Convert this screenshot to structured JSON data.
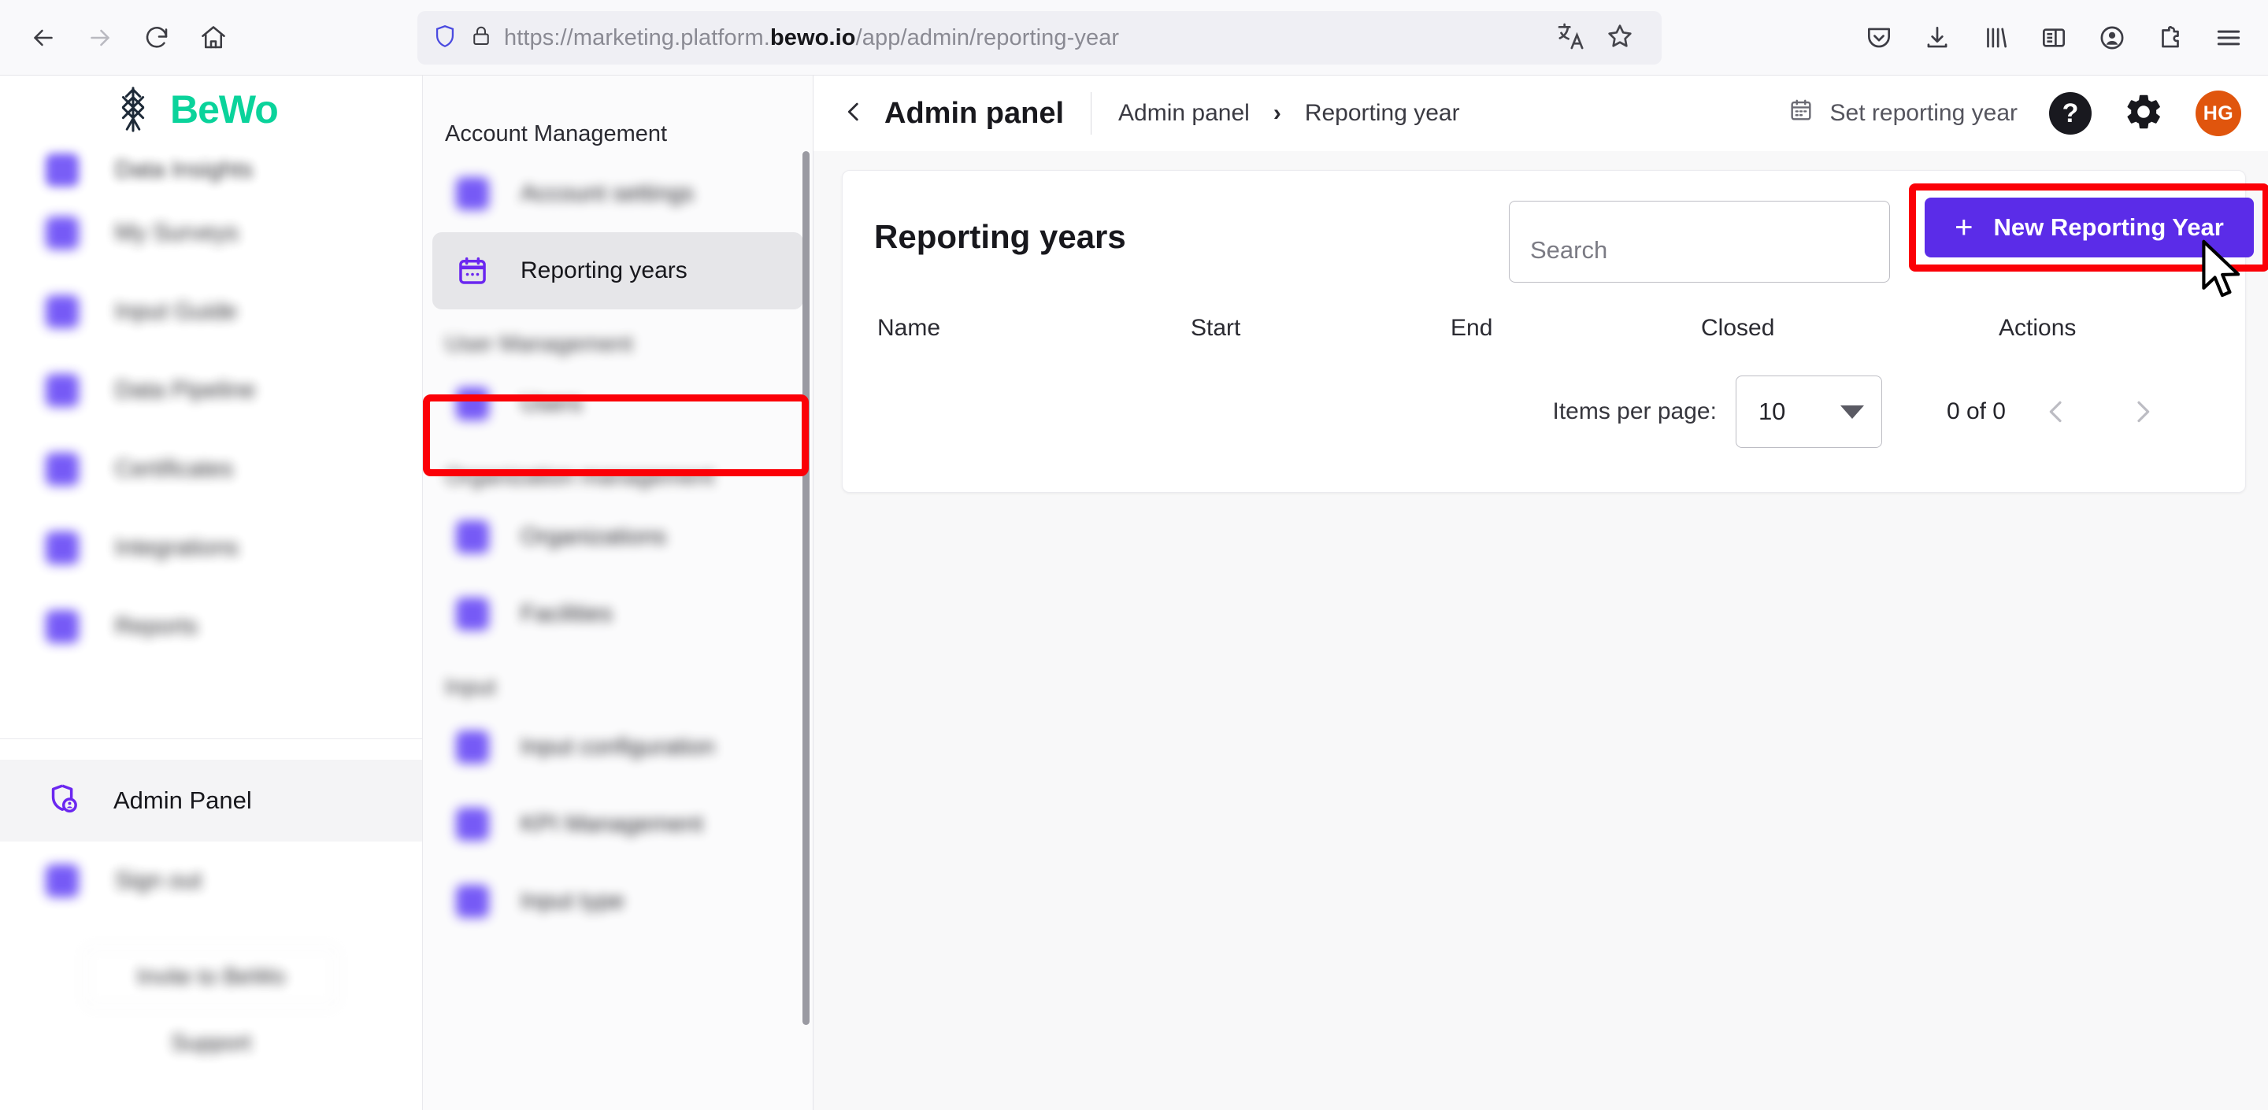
{
  "browser": {
    "url_prefix": "https://marketing.platform.",
    "url_domain": "bewo.io",
    "url_suffix": "/app/admin/reporting-year",
    "back_icon": "back-arrow-icon",
    "forward_icon": "forward-arrow-icon",
    "reload_icon": "reload-icon",
    "home_icon": "home-icon",
    "shield_icon": "shield-icon",
    "lock_icon": "lock-icon",
    "translate_icon": "translate-icon",
    "bookmark_icon": "star-icon",
    "toolbar_icons": [
      "pocket-icon",
      "download-icon",
      "library-icon",
      "sidebar-icon",
      "account-icon",
      "extensions-icon",
      "menu-icon"
    ]
  },
  "sidebar": {
    "logo_word": "BeWo",
    "items": [
      {
        "label": "Data Insights"
      },
      {
        "label": "My Surveys"
      },
      {
        "label": "Input Guide"
      },
      {
        "label": "Data Pipeline"
      },
      {
        "label": "Certificates"
      },
      {
        "label": "Integrations"
      },
      {
        "label": "Reports"
      }
    ],
    "admin_panel": "Admin Panel",
    "sign_out": "Sign out",
    "invite": "Invite to BeWo",
    "support": "Support"
  },
  "subnav": {
    "groups": [
      {
        "title": "Account Management",
        "items": [
          {
            "label": "Account settings",
            "active": false,
            "blurred": true
          },
          {
            "label": "Reporting years",
            "active": true,
            "blurred": false
          }
        ]
      },
      {
        "title": "User Management",
        "items": [
          {
            "label": "Users",
            "active": false,
            "blurred": true
          }
        ]
      },
      {
        "title": "Organization management",
        "items": [
          {
            "label": "Organizations",
            "active": false,
            "blurred": true
          },
          {
            "label": "Facilities",
            "active": false,
            "blurred": true
          }
        ]
      },
      {
        "title": "Input",
        "items": [
          {
            "label": "Input configuration",
            "active": false,
            "blurred": true
          },
          {
            "label": "KPI Management",
            "active": false,
            "blurred": true
          },
          {
            "label": "Input type",
            "active": false,
            "blurred": true
          }
        ]
      }
    ]
  },
  "header": {
    "back_icon": "chevron-left-icon",
    "title": "Admin panel",
    "breadcrumb": [
      "Admin panel",
      "Reporting year"
    ],
    "breadcrumb_separator": "›",
    "set_reporting_year": "Set reporting year",
    "calendar_icon": "calendar-icon",
    "help_label": "?",
    "gear_icon": "gear-icon",
    "avatar_initials": "HG"
  },
  "main": {
    "card_title": "Reporting years",
    "search_placeholder": "Search",
    "search_value": "",
    "new_button_label": "New Reporting Year",
    "new_button_plus": "+",
    "table_headers": [
      "Name",
      "Start",
      "End",
      "Closed",
      "Actions"
    ],
    "rows": [],
    "paginator": {
      "items_per_page_label": "Items per page:",
      "items_per_page_value": "10",
      "range_label": "0 of 0",
      "prev_icon": "chevron-left-icon",
      "next_icon": "chevron-right-icon"
    }
  },
  "colors": {
    "brand_green": "#0ad39b",
    "brand_dark": "#1e2a38",
    "accent_purple": "#5b2ce8",
    "nav_icon_purple": "#6b4df6",
    "annotation_red": "#fb0007",
    "avatar_orange": "#e0550d"
  }
}
